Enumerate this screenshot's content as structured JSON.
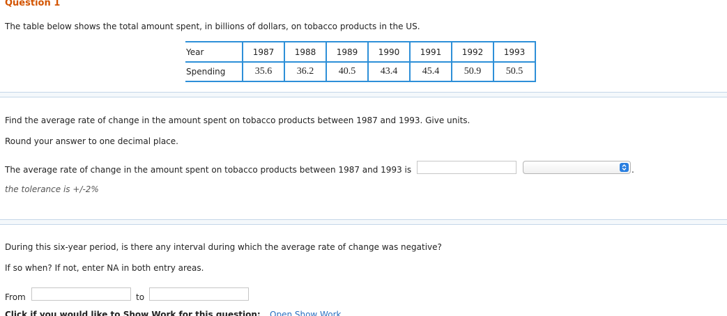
{
  "question": {
    "title": "Question 1",
    "intro": "The table below shows the total amount spent, in billions of dollars, on tobacco products in the US."
  },
  "table": {
    "row_labels": [
      "Year",
      "Spending"
    ],
    "years": [
      "1987",
      "1988",
      "1989",
      "1990",
      "1991",
      "1992",
      "1993"
    ],
    "spending": [
      "35.6",
      "36.2",
      "40.5",
      "43.4",
      "45.4",
      "50.9",
      "50.5"
    ]
  },
  "part1": {
    "prompt": "Find the average rate of change in the amount spent on tobacco products between 1987 and 1993. Give units.",
    "round_note": "Round your answer to one decimal place.",
    "answer_sentence": "The average rate of change in the amount spent on tobacco products between 1987 and 1993 is",
    "answer_value": "",
    "units_selected": "",
    "period_after": ".",
    "tolerance": "the tolerance is +/-2%"
  },
  "part2": {
    "prompt": "During this six-year period, is there any interval during which the average rate of change was negative?",
    "instruction": "If so when? If not, enter NA in both entry areas.",
    "from_label": "From",
    "from_value": "",
    "to_label": "to",
    "to_value": ""
  },
  "footer": {
    "show_work_text": "Click if you would like to Show Work for this question:",
    "show_work_link": "Open Show Work"
  },
  "colors": {
    "title": "#d35400",
    "table_border": "#2d8fd8",
    "select_arrow": "#2a7fe0",
    "link": "#2a6fc0"
  }
}
